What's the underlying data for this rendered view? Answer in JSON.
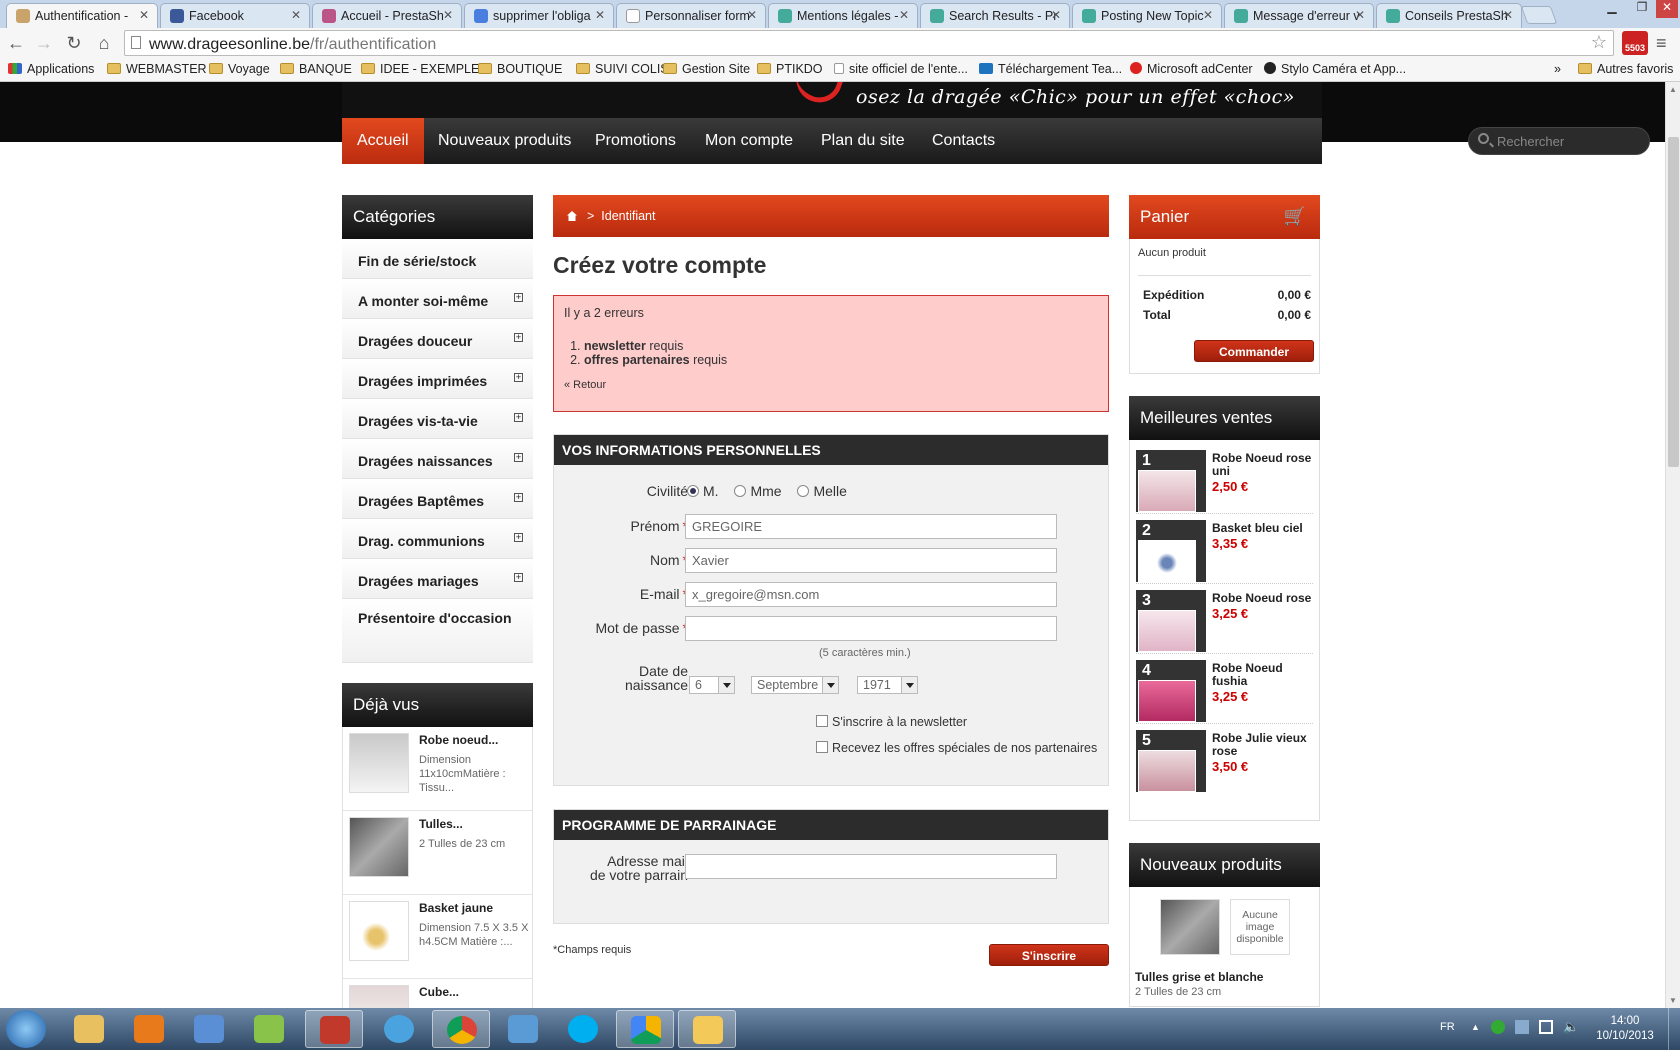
{
  "browser": {
    "tabs": [
      {
        "title": "Authentification - "
      },
      {
        "title": "Facebook"
      },
      {
        "title": "Accueil - PrestaSh"
      },
      {
        "title": "supprimer l'obliga"
      },
      {
        "title": "Personnaliser form"
      },
      {
        "title": "Mentions légales -"
      },
      {
        "title": "Search Results - Pr"
      },
      {
        "title": "Posting New Topic"
      },
      {
        "title": "Message d'erreur v"
      },
      {
        "title": "Conseils PrestaSh"
      }
    ],
    "url_host": "www.drageesonline.be",
    "url_path": "/fr/authentification",
    "ext_badge": "5503",
    "bookmarks": [
      "Applications",
      "WEBMASTER",
      "Voyage",
      "BANQUE",
      "IDEE - EXEMPLE",
      "BOUTIQUE",
      "SUIVI COLIS",
      "Gestion Site",
      "PTIKDO",
      "site officiel de l'ente...",
      "Téléchargement Tea...",
      "Microsoft adCenter",
      "Stylo Caméra et App..."
    ],
    "bookmarks_more": "»",
    "other_bookmarks": "Autres favoris"
  },
  "site": {
    "slogan": "osez la dragée «Chic» pour un effet «choc»",
    "menu": [
      "Accueil",
      "Nouveaux produits",
      "Promotions",
      "Mon compte",
      "Plan du site",
      "Contacts"
    ],
    "search_placeholder": "Rechercher"
  },
  "left": {
    "categories_title": "Catégories",
    "categories": [
      {
        "label": "Fin de série/stock",
        "expandable": false
      },
      {
        "label": "A monter soi-même",
        "expandable": true
      },
      {
        "label": "Dragées douceur",
        "expandable": true
      },
      {
        "label": "Dragées imprimées",
        "expandable": true
      },
      {
        "label": "Dragées vis-ta-vie",
        "expandable": true
      },
      {
        "label": "Dragées naissances",
        "expandable": true
      },
      {
        "label": "Dragées Baptêmes",
        "expandable": true
      },
      {
        "label": "Drag. communions",
        "expandable": true
      },
      {
        "label": "Dragées mariages",
        "expandable": true
      },
      {
        "label": "Présentoire d'occasion",
        "expandable": false
      }
    ],
    "seen_title": "Déjà vus",
    "seen": [
      {
        "title": "Robe noeud...",
        "desc": "Dimension 11x10cmMatière : Tissu..."
      },
      {
        "title": "Tulles...",
        "desc": "2 Tulles de 23 cm"
      },
      {
        "title": "Basket jaune",
        "desc": "Dimension 7.5 X 3.5 X h4.5CM Matière :..."
      },
      {
        "title": "Cube...",
        "desc": ""
      }
    ]
  },
  "center": {
    "breadcrumb": "Identifiant",
    "breadcrumb_sep": ">",
    "title": "Créez votre compte",
    "errors_intro": "Il y a 2 erreurs",
    "errors": [
      {
        "field": "newsletter",
        "msg": "requis"
      },
      {
        "field": "offres partenaires",
        "msg": "requis"
      }
    ],
    "back_link": "« Retour",
    "personal_title": "VOS INFORMATIONS PERSONNELLES",
    "civility_label": "Civilité",
    "civility_options": [
      "M.",
      "Mme",
      "Melle"
    ],
    "civility_selected": "M.",
    "firstname_label": "Prénom",
    "firstname_value": "GREGOIRE",
    "lastname_label": "Nom",
    "lastname_value": "Xavier",
    "email_label": "E-mail",
    "email_value": "x_gregoire@msn.com",
    "password_label": "Mot de passe",
    "password_hint": "(5 caractères min.)",
    "birth_label": "Date de naissance",
    "birth_day": "6",
    "birth_month": "Septembre",
    "birth_year": "1971",
    "newsletter_label": "S'inscrire à la newsletter",
    "partners_label": "Recevez les offres spéciales de nos partenaires",
    "referral_title": "PROGRAMME DE PARRAINAGE",
    "referral_label": "Adresse mail de votre parrain",
    "required_note": "*Champs requis",
    "submit_label": "S'inscrire",
    "required_mark": "*"
  },
  "right": {
    "cart_title": "Panier",
    "cart_empty": "Aucun produit",
    "shipping_label": "Expédition",
    "shipping_value": "0,00 €",
    "total_label": "Total",
    "total_value": "0,00 €",
    "checkout_label": "Commander",
    "best_title": "Meilleures ventes",
    "best": [
      {
        "rank": "1",
        "title": "Robe Noeud rose uni",
        "price": "2,50 €"
      },
      {
        "rank": "2",
        "title": "Basket bleu ciel",
        "price": "3,35 €"
      },
      {
        "rank": "3",
        "title": "Robe Noeud rose",
        "price": "3,25 €"
      },
      {
        "rank": "4",
        "title": "Robe Noeud fushia",
        "price": "3,25 €"
      },
      {
        "rank": "5",
        "title": "Robe Julie vieux rose",
        "price": "3,50 €"
      }
    ],
    "new_title": "Nouveaux produits",
    "no_image": "Aucune image disponible",
    "new_item_title": "Tulles grise et blanche",
    "new_item_desc": "2 Tulles de 23 cm"
  },
  "taskbar": {
    "lang": "FR",
    "time": "14:00",
    "date": "10/10/2013"
  },
  "colors": {
    "accent": "#cc3a17",
    "error_bg": "#ffcccc",
    "price": "#cc0000"
  }
}
